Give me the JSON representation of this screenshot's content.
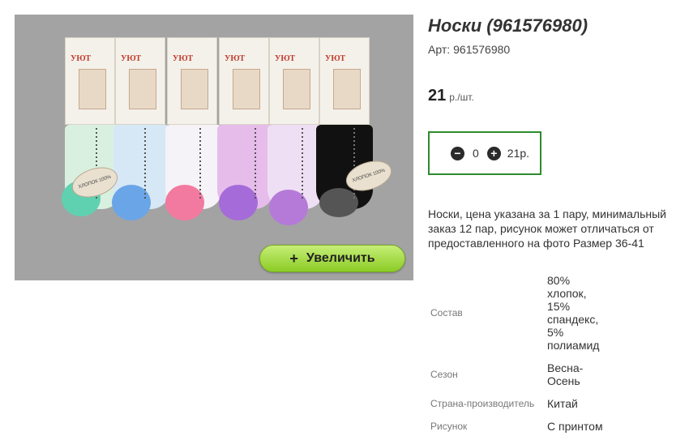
{
  "product": {
    "title": "Носки (961576980)",
    "sku_label": "Арт:",
    "sku_value": "961576980",
    "price": "21",
    "price_unit": "р./шт.",
    "zoom_button": "Увеличить",
    "zoom_icon": "plus-icon",
    "description": "Носки, цена указана за 1 пару, минимальный заказ 12 пар, рисунок может отличаться от предоставленного на фото Размер 36-41"
  },
  "cart": {
    "quantity": "0",
    "total": "21р.",
    "minus_icon": "minus-circle-icon",
    "plus_icon": "plus-circle-icon",
    "border_color": "#2e8b2e"
  },
  "specs": [
    {
      "key": "Состав",
      "value": "80% хлопок, 15% спандекс, 5% полиамид"
    },
    {
      "key": "Сезон",
      "value": "Весна-Осень"
    },
    {
      "key": "Страна-производитель",
      "value": "Китай"
    },
    {
      "key": "Рисунок",
      "value": "С принтом"
    }
  ],
  "photo": {
    "pack_brand": "УЮТ",
    "label_text": "ХЛОПОК 100%"
  }
}
